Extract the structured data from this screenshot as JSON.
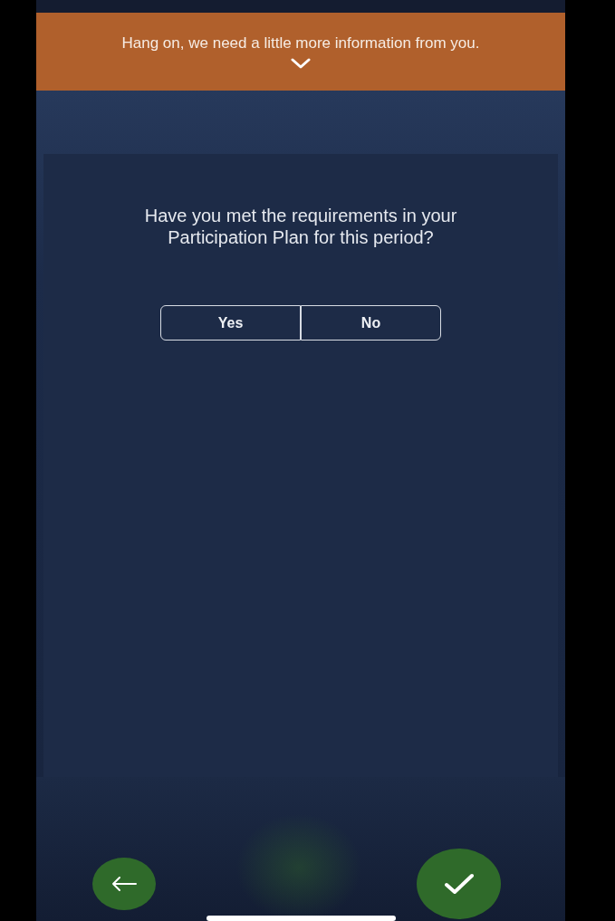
{
  "banner": {
    "message": "Hang on, we need a little more information from you."
  },
  "question": {
    "text": "Have you met the requirements in your Participation Plan for this period?",
    "options": [
      {
        "label": "Yes",
        "selected": false
      },
      {
        "label": "No",
        "selected": false
      }
    ]
  }
}
